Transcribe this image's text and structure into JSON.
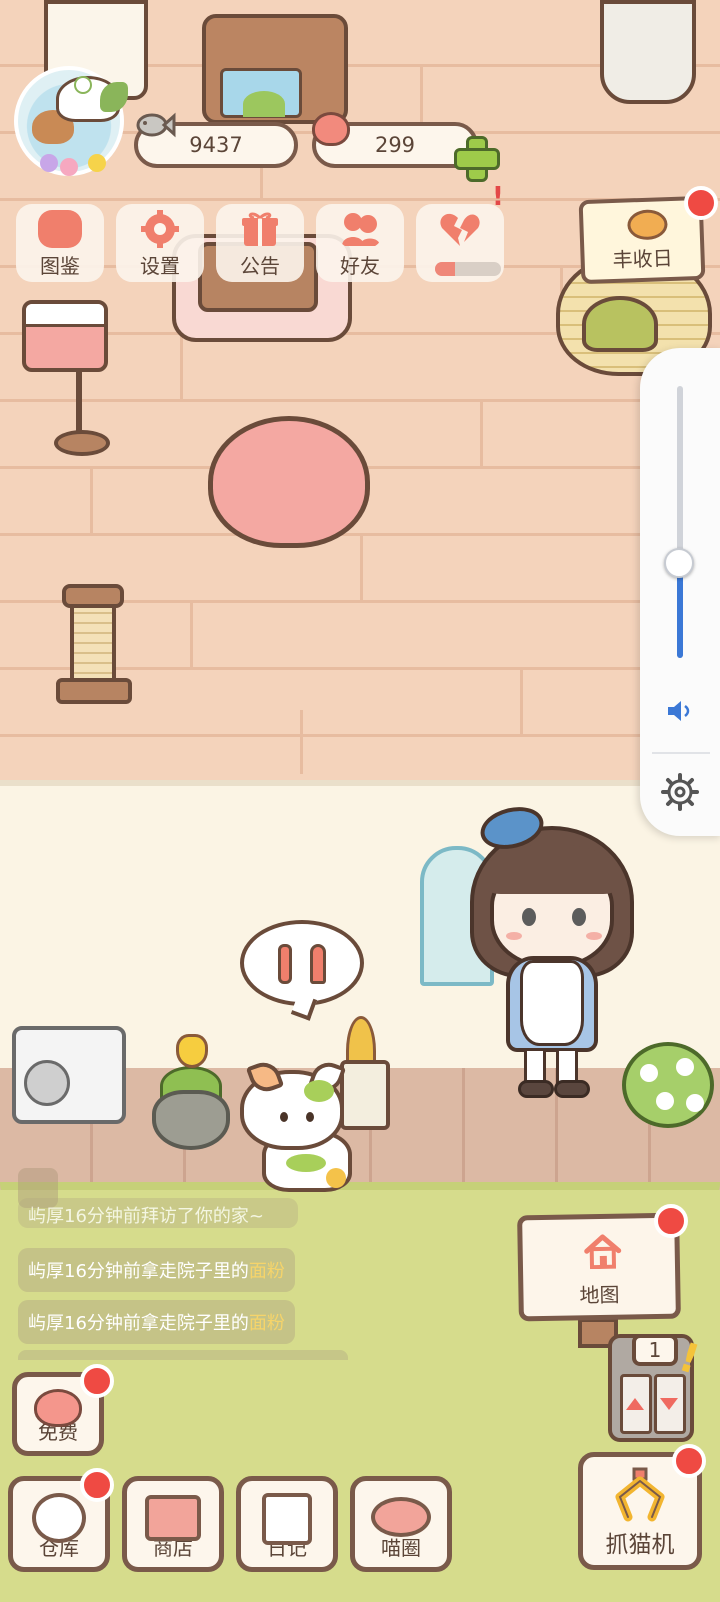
{
  "hud": {
    "fish_coins": "9437",
    "hearts": "299"
  },
  "menu": [
    {
      "label": "图鉴",
      "icon": "cat-face-icon"
    },
    {
      "label": "设置",
      "icon": "gear-icon"
    },
    {
      "label": "公告",
      "icon": "gift-icon"
    },
    {
      "label": "好友",
      "icon": "friends-icon"
    },
    {
      "label": "",
      "icon": "broken-heart-icon",
      "progress": 0.3
    }
  ],
  "event": {
    "label": "丰收日"
  },
  "volume": {
    "level": 0.35
  },
  "feed": {
    "partial": "屿厚16分钟前拜访了你的家~",
    "lines": [
      {
        "prefix": "屿厚16分钟前拿走院子里的",
        "item": "面粉"
      },
      {
        "prefix": "屿厚16分钟前拿走院子里的",
        "item": "面粉"
      }
    ]
  },
  "map_sign": {
    "label": "地图"
  },
  "elevator": {
    "floor": "1"
  },
  "buttons": {
    "free": "免费",
    "warehouse": "仓库",
    "shop": "商店",
    "diary": "日记",
    "meow_circle": "喵圈",
    "claw_machine": "抓猫机"
  },
  "colors": {
    "accent_red": "#ef4a43",
    "outline_brown": "#7a5a4a",
    "floor_peach": "#f4d3bb",
    "volume_blue": "#3b78d6"
  }
}
